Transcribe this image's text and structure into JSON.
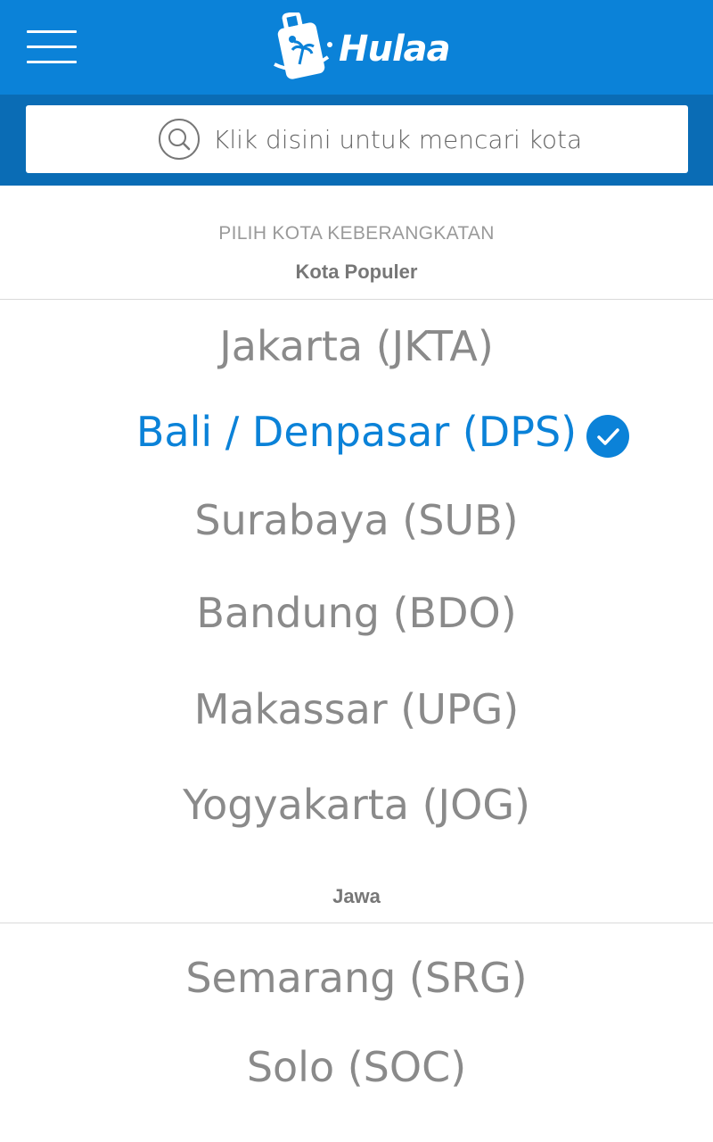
{
  "header": {
    "brand_name": "Hulaa",
    "brand_color": "#0b82d8",
    "menu_icon": "hamburger-menu-icon"
  },
  "search": {
    "placeholder": "Klik disini untuk mencari kota",
    "icon": "search-icon"
  },
  "page": {
    "section_title": "PILIH KOTA KEBERANGKATAN"
  },
  "groups": [
    {
      "label": "Kota Populer",
      "cities": [
        {
          "label": "Jakarta (JKTA)",
          "selected": false
        },
        {
          "label": "Bali / Denpasar (DPS)",
          "selected": true
        },
        {
          "label": "Surabaya (SUB)",
          "selected": false
        },
        {
          "label": "Bandung (BDO)",
          "selected": false
        },
        {
          "label": "Makassar (UPG)",
          "selected": false
        },
        {
          "label": "Yogyakarta (JOG)",
          "selected": false
        }
      ]
    },
    {
      "label": "Jawa",
      "cities": [
        {
          "label": "Semarang (SRG)",
          "selected": false
        },
        {
          "label": "Solo (SOC)",
          "selected": false
        }
      ]
    }
  ]
}
